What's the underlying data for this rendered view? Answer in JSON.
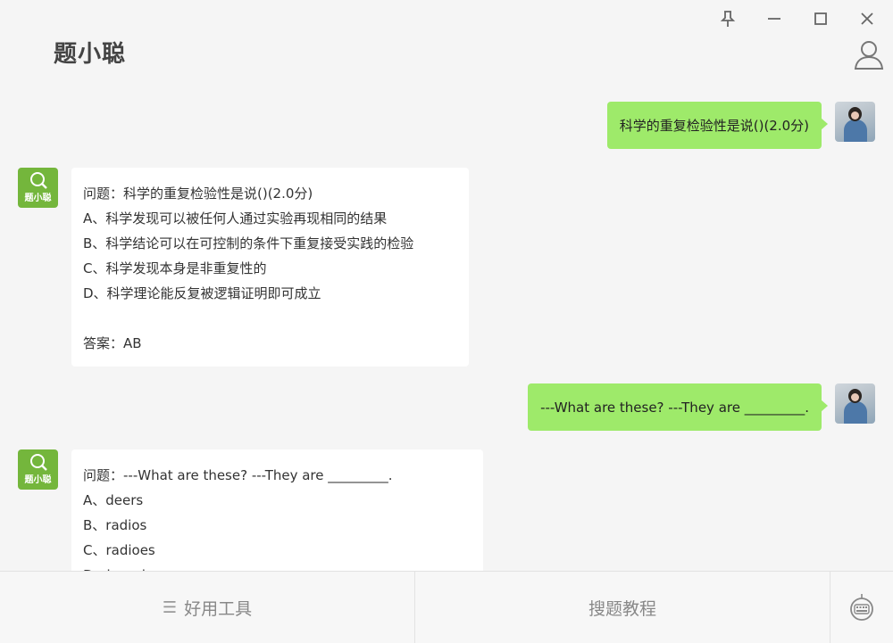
{
  "window": {
    "controls": [
      "pin",
      "minimize",
      "maximize",
      "close"
    ]
  },
  "app": {
    "title": "题小聪"
  },
  "bot": {
    "avatar_label": "题小聪"
  },
  "messages": [
    {
      "from": "me",
      "text": "科学的重复检验性是说()(2.0分)"
    },
    {
      "from": "bot",
      "lines": [
        "问题：科学的重复检验性是说()(2.0分)",
        "A、科学发现可以被任何人通过实验再现相同的结果",
        "B、科学结论可以在可控制的条件下重复接受实践的检验",
        "C、科学发现本身是非重复性的",
        "D、科学理论能反复被逻辑证明即可成立",
        "",
        "答案：AB"
      ]
    },
    {
      "from": "me",
      "text": "---What are these? ---They are _________."
    },
    {
      "from": "bot",
      "lines": [
        "问题：---What are these? ---They are _________.",
        "A、deers",
        "B、radios",
        "C、radioes",
        "D、breads"
      ]
    }
  ],
  "bottom_tabs": {
    "tools_label": "好用工具",
    "tutorial_label": "搜题教程"
  },
  "colors": {
    "my_bubble": "#9eea6a",
    "bot_avatar": "#74b63c",
    "background": "#f5f5f5"
  }
}
